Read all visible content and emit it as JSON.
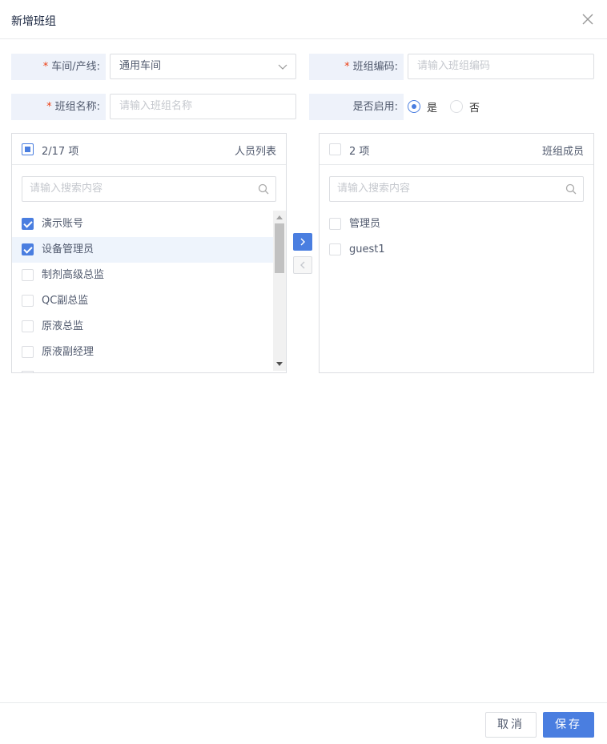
{
  "dialog": {
    "title": "新增班组"
  },
  "form": {
    "workshop": {
      "required_mark": "*",
      "label": "车间/产线:",
      "value": "通用车间"
    },
    "team_code": {
      "required_mark": "*",
      "label": "班组编码:",
      "placeholder": "请输入班组编码"
    },
    "team_name": {
      "required_mark": "*",
      "label": "班组名称:",
      "placeholder": "请输入班组名称"
    },
    "enabled": {
      "label": "是否启用:",
      "options": [
        "是",
        "否"
      ],
      "selected": "是"
    }
  },
  "left_panel": {
    "count": "2/17 项",
    "title": "人员列表",
    "search_placeholder": "请输入搜索内容",
    "items": [
      {
        "label": "演示账号",
        "checked": true
      },
      {
        "label": "设备管理员",
        "checked": true
      },
      {
        "label": "制剂高级总监",
        "checked": false
      },
      {
        "label": "QC副总监",
        "checked": false
      },
      {
        "label": "原液总监",
        "checked": false
      },
      {
        "label": "原液副经理",
        "checked": false
      }
    ]
  },
  "right_panel": {
    "count": "2 项",
    "title": "班组成员",
    "search_placeholder": "请输入搜索内容",
    "items": [
      {
        "label": "管理员",
        "checked": false
      },
      {
        "label": "guest1",
        "checked": false
      }
    ]
  },
  "transfer": {
    "to_right_icon": "chevron-right-icon",
    "to_left_icon": "chevron-left-icon"
  },
  "footer": {
    "cancel_label": "取消",
    "save_label": "保存"
  },
  "colors": {
    "primary": "#4a7ee0",
    "label_bg": "#eef2fa",
    "required": "#ed4014",
    "highlight_row": "#eef4fc"
  }
}
